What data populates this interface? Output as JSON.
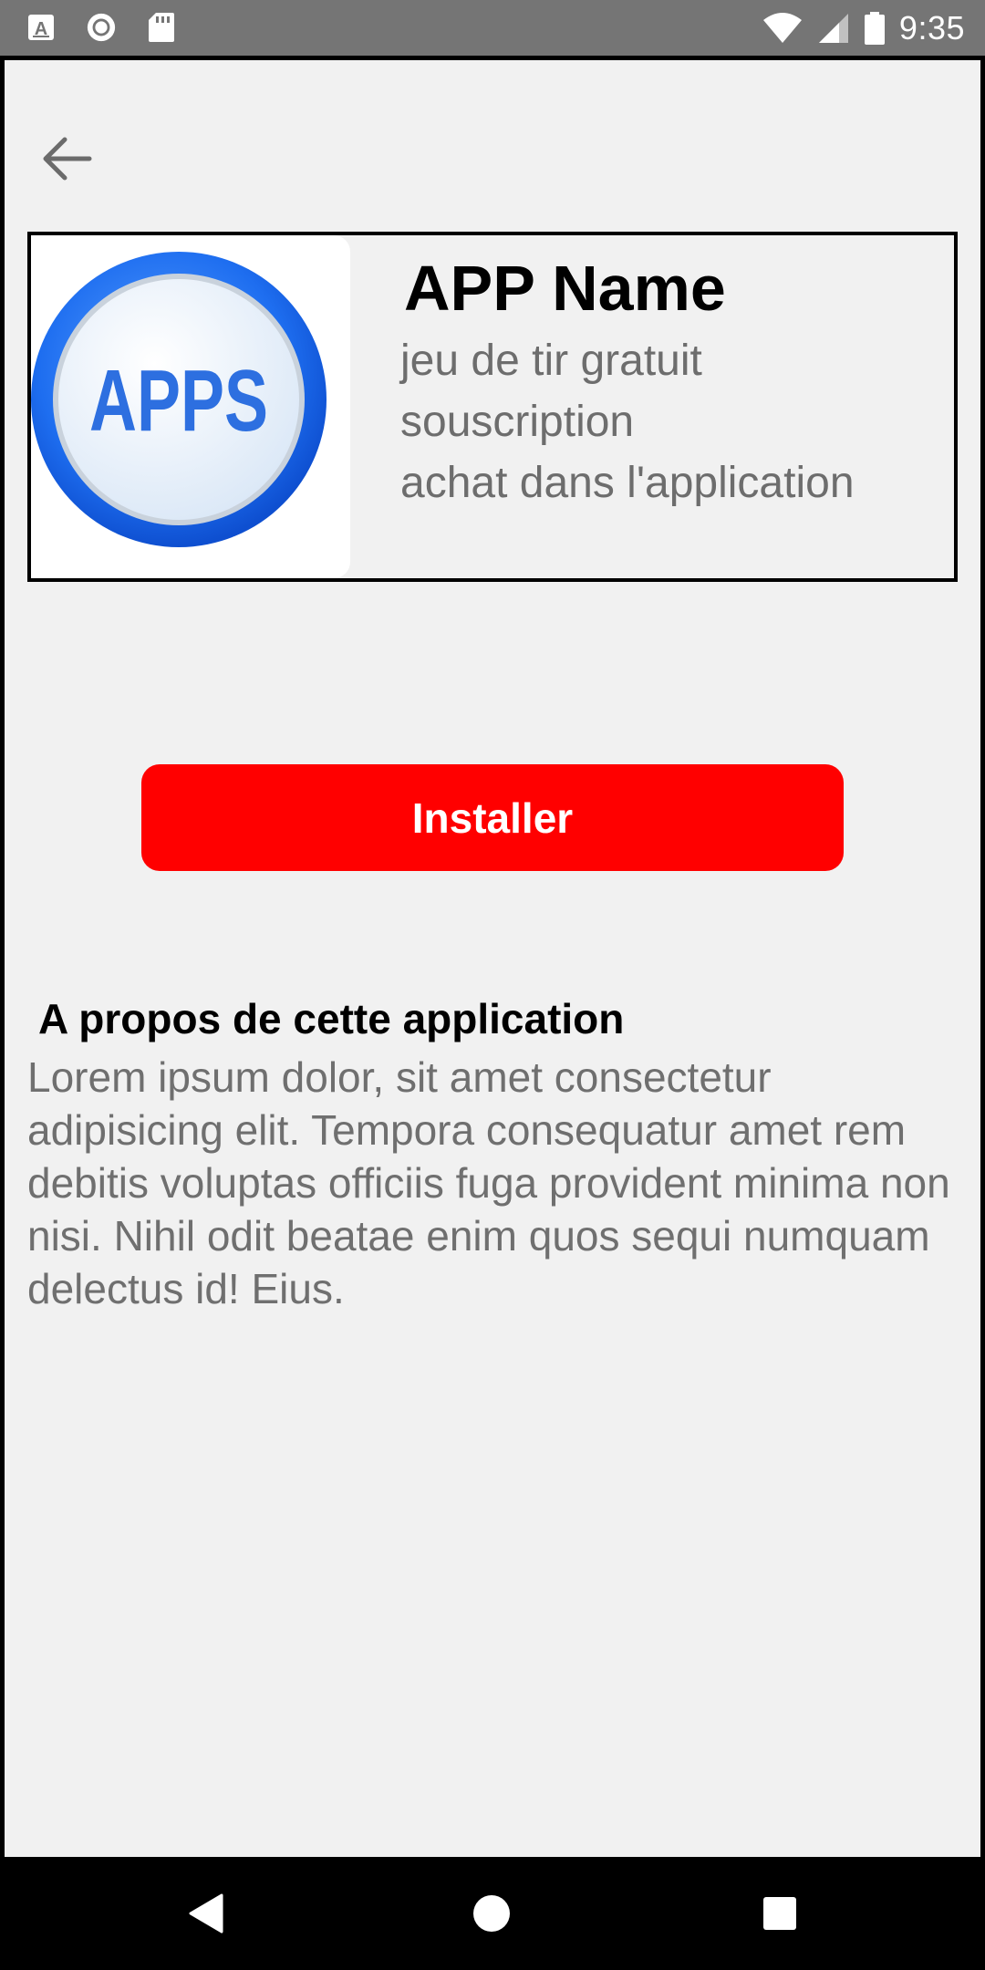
{
  "status_bar": {
    "time": "9:35",
    "icons": [
      "a-notification-icon",
      "circle-notification-icon",
      "sd-card-icon",
      "wifi-icon",
      "signal-icon",
      "battery-icon"
    ]
  },
  "toolbar": {
    "back_icon": "arrow-back-icon"
  },
  "app": {
    "logo_text": "APPS",
    "name": "APP Name",
    "meta": [
      "jeu de tir gratuit",
      "souscription",
      "achat dans l'application"
    ]
  },
  "install_button": {
    "label": "Installer",
    "color": "#ff0000"
  },
  "about": {
    "title": "A propos de cette application",
    "body": "Lorem ipsum dolor, sit amet consectetur adipisicing elit. Tempora consequatur amet rem debitis voluptas officiis fuga provident minima non nisi. Nihil odit beatae enim quos sequi numquam delectus id! Eius."
  },
  "nav_bar": {
    "icons": [
      "back-triangle-icon",
      "home-circle-icon",
      "recents-square-icon"
    ]
  }
}
